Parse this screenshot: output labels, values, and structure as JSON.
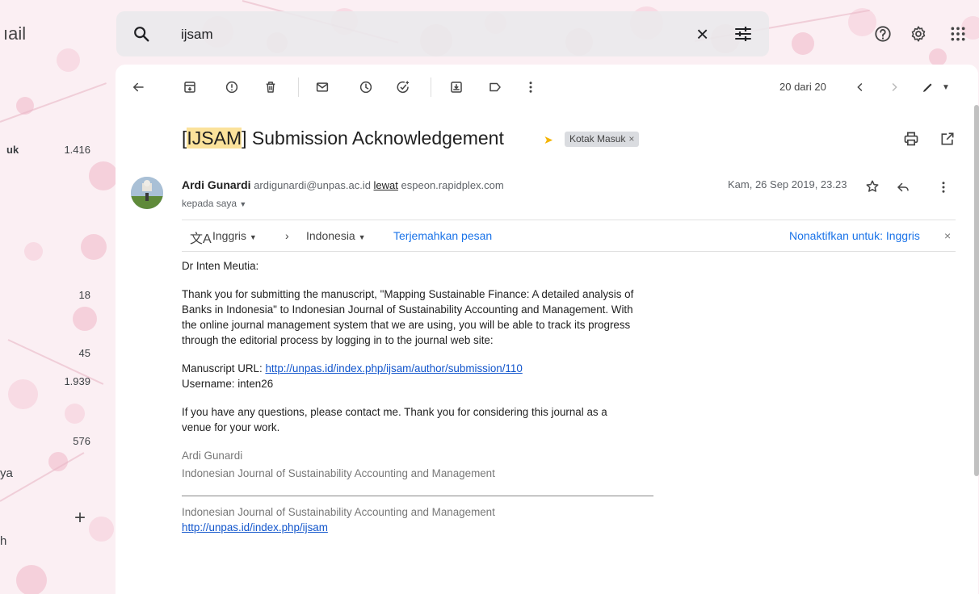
{
  "colors": {
    "accent": "#1a73e8",
    "highlight": "#fbe29b",
    "label_arrow": "#f4b400"
  },
  "nav": {
    "logo_fragment": "ıail",
    "inbox_label": "uk",
    "inbox_count": "1.416",
    "count_a": "18",
    "count_b": "45",
    "count_c": "1.939",
    "count_d": "576",
    "label_ya": "ya",
    "label_h": "h",
    "add_label": "+"
  },
  "search": {
    "value": "ijsam"
  },
  "toolbar": {
    "pager": "20 dari 20"
  },
  "email": {
    "subject_highlight": "IJSAM",
    "subject_rest": "] Submission Acknowledgement",
    "subject_open": "[",
    "label": "Kotak Masuk",
    "sender_name": "Ardi Gunardi",
    "sender_email": "ardigunardi@unpas.ac.id",
    "via_word": "lewat",
    "via_domain": "espeon.rapidplex.com",
    "to": "kepada saya",
    "date": "Kam, 26 Sep 2019, 23.23"
  },
  "translate": {
    "from": "Inggris",
    "to": "Indonesia",
    "action": "Terjemahkan pesan",
    "disable": "Nonaktifkan untuk: Inggris"
  },
  "body": {
    "greeting": "Dr Inten Meutia:",
    "para1": "Thank you for submitting the manuscript, \"Mapping Sustainable Finance: A detailed analysis of Banks in Indonesia\" to Indonesian Journal of Sustainability Accounting and Management. With the online journal management system that we are using, you will be able to track its progress through the editorial process by logging in to the journal web site:",
    "url_label": "Manuscript URL: ",
    "url": "http://unpas.id/index.php/ijsam/author/submission/110",
    "username": "Username: inten26",
    "para3": "If you have any questions, please contact me. Thank you for considering this journal as a venue for your work.",
    "sig_name": "Ardi Gunardi",
    "sig_journal": "Indonesian Journal of Sustainability Accounting and Management",
    "footer_journal": "Indonesian Journal of Sustainability Accounting and Management",
    "footer_url": "http://unpas.id/index.php/ijsam"
  }
}
